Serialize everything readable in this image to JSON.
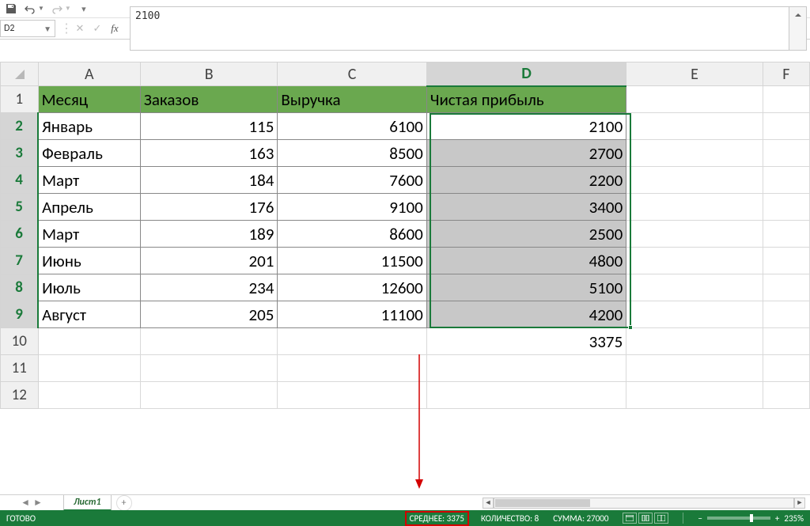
{
  "qat": {
    "save": "💾",
    "undo": "↶",
    "redo": "↷",
    "custom": "▾"
  },
  "nameBox": "D2",
  "formulaValue": "2100",
  "columns": [
    "A",
    "B",
    "C",
    "D",
    "E",
    "F"
  ],
  "activeColumn": "D",
  "activeRowFrom": 2,
  "activeRowTo": 9,
  "headers": {
    "A": "Месяц",
    "B": "Заказов",
    "C": "Выручка",
    "D": "Чистая прибыль"
  },
  "rows": [
    {
      "n": 1,
      "A": "Месяц",
      "B": "Заказов",
      "C": "Выручка",
      "D": "Чистая прибыль",
      "hdr": true
    },
    {
      "n": 2,
      "A": "Январь",
      "B": 115,
      "C": 6100,
      "D": 2100
    },
    {
      "n": 3,
      "A": "Февраль",
      "B": 163,
      "C": 8500,
      "D": 2700
    },
    {
      "n": 4,
      "A": "Март",
      "B": 184,
      "C": 7600,
      "D": 2200
    },
    {
      "n": 5,
      "A": "Апрель",
      "B": 176,
      "C": 9100,
      "D": 3400
    },
    {
      "n": 6,
      "A": "Март",
      "B": 189,
      "C": 8600,
      "D": 2500
    },
    {
      "n": 7,
      "A": "Июнь",
      "B": 201,
      "C": 11500,
      "D": 4800
    },
    {
      "n": 8,
      "A": "Июль",
      "B": 234,
      "C": 12600,
      "D": 5100
    },
    {
      "n": 9,
      "A": "Август",
      "B": 205,
      "C": 11100,
      "D": 4200
    },
    {
      "n": 10,
      "A": "",
      "B": "",
      "C": "",
      "D": 3375
    },
    {
      "n": 11,
      "A": "",
      "B": "",
      "C": "",
      "D": ""
    },
    {
      "n": 12,
      "A": "",
      "B": "",
      "C": "",
      "D": ""
    }
  ],
  "sheetTab": "Лист1",
  "status": {
    "ready": "ГОТОВО",
    "avg_label": "СРЕДНЕЕ:",
    "avg_val": "3375",
    "count_label": "КОЛИЧЕСТВО:",
    "count_val": "8",
    "sum_label": "СУММА:",
    "sum_val": "27000",
    "zoom": "235%"
  }
}
